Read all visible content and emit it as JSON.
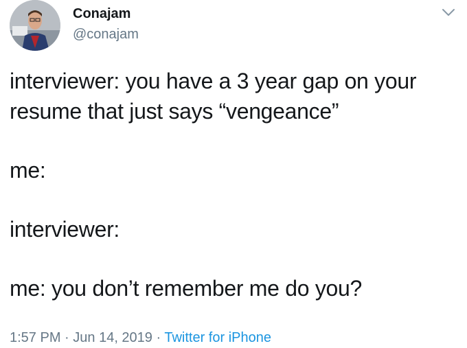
{
  "author": {
    "display_name": "Conajam",
    "handle": "@conajam",
    "avatar": "profile-photo"
  },
  "menu_icon": "chevron-down-icon",
  "tweet": {
    "lines": [
      "interviewer: you have a 3 year gap on your resume that just says “vengeance”",
      "me:",
      "interviewer:",
      "me: you don’t remember me do you?"
    ]
  },
  "meta": {
    "time": "1:57 PM",
    "separator1": " · ",
    "date": "Jun 14, 2019",
    "separator2": " · ",
    "source": "Twitter for iPhone"
  },
  "colors": {
    "text": "#14171a",
    "secondary": "#657786",
    "link": "#1b95e0"
  }
}
